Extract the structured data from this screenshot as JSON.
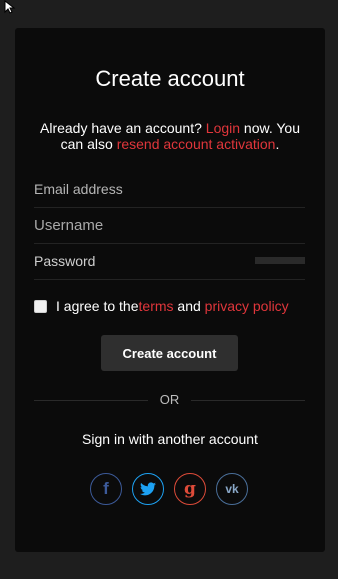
{
  "form": {
    "title": "Create account",
    "intro_prefix": "Already have an account? ",
    "login_link": "Login",
    "intro_middle": " now. You can also ",
    "resend_link": "resend account activation",
    "intro_suffix": "."
  },
  "fields": {
    "email_label": "Email address",
    "username_label": "Username",
    "password_label": "Password"
  },
  "agree": {
    "prefix": "I agree to the ",
    "terms_link": "terms",
    "middle": " and ",
    "privacy_link": "privacy policy",
    "checked": false
  },
  "create_button": "Create account",
  "divider": "OR",
  "social": {
    "heading": "Sign in with another account",
    "buttons": [
      {
        "name": "facebook",
        "glyph": "f",
        "icon": "facebook-icon",
        "color": "#3c5a99"
      },
      {
        "name": "twitter",
        "glyph": "",
        "icon": "twitter-icon",
        "color": "#1da1f2"
      },
      {
        "name": "google",
        "glyph": "g",
        "icon": "google-icon",
        "color": "#dd4b39"
      },
      {
        "name": "vk",
        "glyph": "vk",
        "icon": "vk-icon",
        "color": "#4a6f9a"
      }
    ]
  },
  "colors": {
    "accent": "#e0363b",
    "card_bg": "#0b0b0b",
    "page_bg": "#1e1e1e",
    "button_bg": "#2f2f2f"
  }
}
